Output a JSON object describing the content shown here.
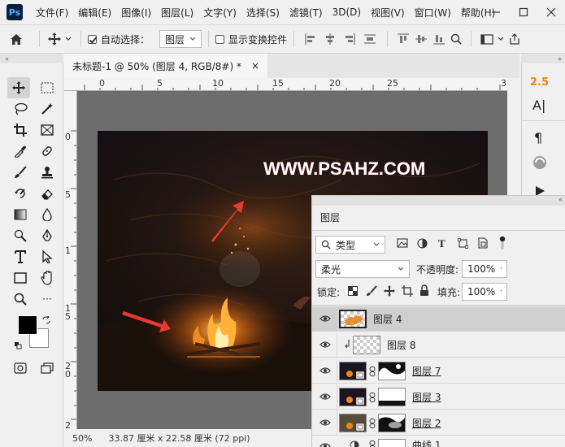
{
  "app": {
    "logo_text": "Ps"
  },
  "menu": {
    "items": [
      "文件(F)",
      "编辑(E)",
      "图像(I)",
      "图层(L)",
      "文字(Y)",
      "选择(S)",
      "滤镜(T)",
      "3D(D)",
      "视图(V)",
      "窗口(W)",
      "帮助(H)"
    ]
  },
  "options_bar": {
    "auto_select_label": "自动选择：",
    "auto_select_checked": true,
    "auto_select_target": "图层",
    "show_transform_label": "显示变换控件",
    "show_transform_checked": false,
    "more_label": "···"
  },
  "document": {
    "tab_title": "未标题-1 @ 50% (图层 4, RGB/8#) *",
    "close_glyph": "×",
    "ruler_h_labels": [
      "0",
      "5",
      "10",
      "15",
      "20",
      "25",
      "3"
    ],
    "ruler_v_labels": [
      "0",
      "5",
      "1",
      "1 5",
      "2 0",
      "2"
    ],
    "watermark_text": "WWW.PSAHZ.COM"
  },
  "status_bar": {
    "zoom": "50%",
    "doc_size": "33.87 厘米 x 22.58 厘米 (72 ppi)"
  },
  "side_panel": {
    "font_size_value": "2.5",
    "text_tool_label": "A|",
    "paragraph_label": "¶"
  },
  "layers_panel": {
    "tab_label": "图层",
    "filter_kind": "类型",
    "blend_mode": "柔光",
    "opacity_label": "不透明度:",
    "opacity_value": "100%",
    "lock_label": "锁定:",
    "fill_label": "填充:",
    "fill_value": "100%",
    "layers": [
      {
        "name": "图层 4",
        "selected": true,
        "underlined": false
      },
      {
        "name": "图层 8",
        "selected": false,
        "underlined": false
      },
      {
        "name": "图层 7",
        "selected": false,
        "underlined": true
      },
      {
        "name": "图层 3",
        "selected": false,
        "underlined": true
      },
      {
        "name": "图层 2",
        "selected": false,
        "underlined": true
      },
      {
        "name": "曲线 1",
        "selected": false,
        "underlined": false
      }
    ]
  },
  "colors": {
    "foreground": "#000000",
    "background": "#ffffff",
    "accent_orange": "#e8851a",
    "arrow_red": "#e53a33"
  }
}
